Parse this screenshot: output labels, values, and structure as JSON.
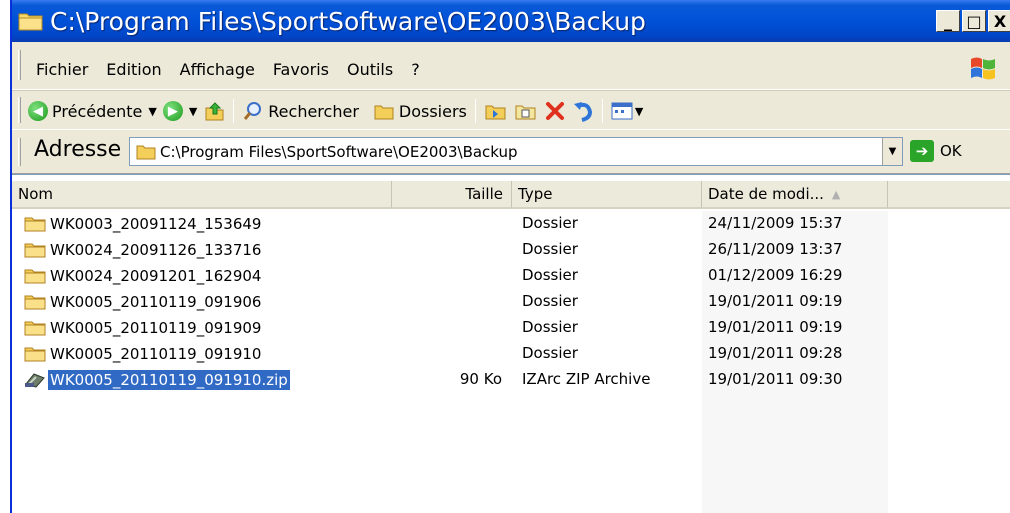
{
  "window": {
    "title": "C:\\Program Files\\SportSoftware\\OE2003\\Backup",
    "buttons": {
      "minimize": "_",
      "maximize": "□",
      "close": "X"
    }
  },
  "menu": {
    "items": [
      "Fichier",
      "Edition",
      "Affichage",
      "Favoris",
      "Outils",
      "?"
    ]
  },
  "toolbar": {
    "back_label": "Précédente",
    "search_label": "Rechercher",
    "folders_label": "Dossiers"
  },
  "address": {
    "label": "Adresse",
    "value": "C:\\Program Files\\SportSoftware\\OE2003\\Backup",
    "go_label": "OK"
  },
  "list": {
    "columns": {
      "name": "Nom",
      "size": "Taille",
      "type": "Type",
      "date": "Date de modi..."
    },
    "rows": [
      {
        "name": "WK0003_20091124_153649",
        "size": "",
        "type": "Dossier",
        "date": "24/11/2009 15:37",
        "icon": "folder-icon"
      },
      {
        "name": "WK0024_20091126_133716",
        "size": "",
        "type": "Dossier",
        "date": "26/11/2009 13:37",
        "icon": "folder-icon"
      },
      {
        "name": "WK0024_20091201_162904",
        "size": "",
        "type": "Dossier",
        "date": "01/12/2009 16:29",
        "icon": "folder-icon"
      },
      {
        "name": "WK0005_20110119_091906",
        "size": "",
        "type": "Dossier",
        "date": "19/01/2011 09:19",
        "icon": "folder-icon"
      },
      {
        "name": "WK0005_20110119_091909",
        "size": "",
        "type": "Dossier",
        "date": "19/01/2011 09:19",
        "icon": "folder-icon"
      },
      {
        "name": "WK0005_20110119_091910",
        "size": "",
        "type": "Dossier",
        "date": "19/01/2011 09:28",
        "icon": "folder-icon"
      },
      {
        "name": "WK0005_20110119_091910.zip",
        "size": "90 Ko",
        "type": "IZArc ZIP Archive",
        "date": "19/01/2011 09:30",
        "icon": "zip-archive-icon",
        "selected": true
      }
    ]
  },
  "colors": {
    "titlebar": "#0051d8",
    "chrome": "#ece9d8",
    "selection": "#316ac5"
  }
}
